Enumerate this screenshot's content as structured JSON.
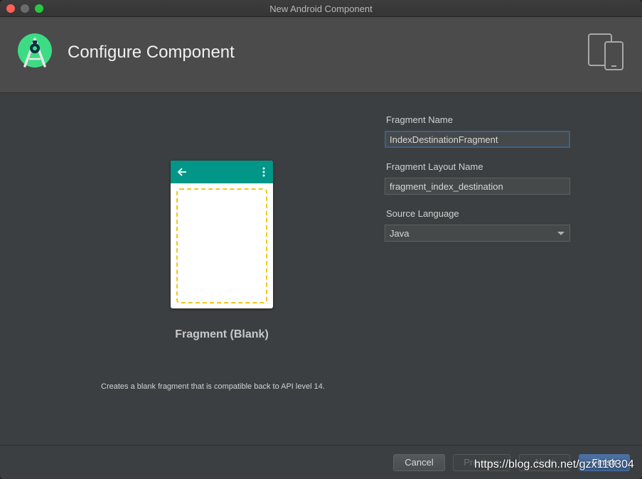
{
  "window": {
    "title": "New Android Component"
  },
  "header": {
    "title": "Configure Component",
    "logo_icon": "android-studio-icon",
    "device_icon": "tablet-phone-icon"
  },
  "preview": {
    "template_name": "Fragment (Blank)",
    "description": "Creates a blank fragment that is compatible back to API level 14.",
    "toolbar_color": "#009688",
    "placeholder_border_color": "#f5c518"
  },
  "form": {
    "fragment_name": {
      "label": "Fragment Name",
      "value": "IndexDestinationFragment"
    },
    "layout_name": {
      "label": "Fragment Layout Name",
      "value": "fragment_index_destination"
    },
    "source_language": {
      "label": "Source Language",
      "value": "Java"
    }
  },
  "footer": {
    "cancel_label": "Cancel",
    "previous_label": "Previous",
    "next_label": "Next",
    "finish_label": "Finish"
  },
  "watermark": "https://blog.csdn.net/gzx110304",
  "colors": {
    "accent": "#3d6185",
    "primary_button": "#4a6fa0"
  }
}
